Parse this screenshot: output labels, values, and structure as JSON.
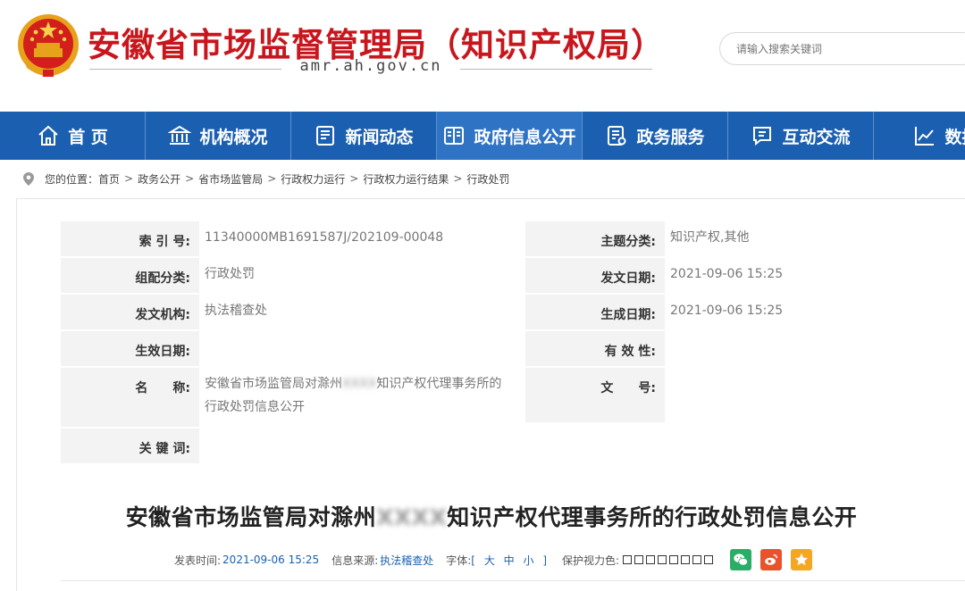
{
  "header": {
    "site_title": "安徽省市场监督管理局（知识产权局）",
    "domain": "amr.ah.gov.cn",
    "search_placeholder": "请输入搜索关键词"
  },
  "nav": {
    "items": [
      {
        "label": "首 页",
        "icon": "home-icon"
      },
      {
        "label": "机构概况",
        "icon": "building-icon"
      },
      {
        "label": "新闻动态",
        "icon": "news-icon"
      },
      {
        "label": "政府信息公开",
        "icon": "open-book-icon",
        "active": true
      },
      {
        "label": "政务服务",
        "icon": "service-icon"
      },
      {
        "label": "互动交流",
        "icon": "chat-icon"
      },
      {
        "label": "数据",
        "icon": "chart-line-icon"
      }
    ]
  },
  "breadcrumb": {
    "prefix": "您的位置：",
    "items": [
      "首页",
      "政务公开",
      "省市场监管局",
      "行政权力运行",
      "行政权力运行结果",
      "行政处罚"
    ],
    "separator": ">"
  },
  "meta": {
    "index_label": "索 引 号:",
    "index_value": "11340000MB1691587J/202109-00048",
    "topic_label": "主题分类:",
    "topic_value": "知识产权,其他",
    "category_label": "组配分类:",
    "category_value": "行政处罚",
    "issue_date_label": "发文日期:",
    "issue_date_value": "2021-09-06 15:25",
    "issuer_label": "发文机构:",
    "issuer_value": "执法稽查处",
    "created_label": "生成日期:",
    "created_value": "2021-09-06 15:25",
    "effective_label": "生效日期:",
    "effective_value": "",
    "validity_label": "有 效 性:",
    "validity_value": "",
    "name_label": "名　　称:",
    "name_value_a": "安徽省市场监管局对滁州",
    "name_value_blur": "XXXX",
    "name_value_b": "知识产权代理事务所的",
    "name_value_c": "行政处罚信息公开",
    "docno_label": "文　　号:",
    "docno_value": "",
    "keywords_label": "关 键 词:",
    "keywords_value": ""
  },
  "article": {
    "title_a": "安徽省市场监管局对滁州",
    "title_blur": "XXXX",
    "title_b": "知识产权代理事务所的行政处罚信息公开",
    "publish_label": "发表时间:",
    "publish_value": "2021-09-06 15:25",
    "source_label": "信息来源:",
    "source_value": "执法稽查处",
    "font_label": "字体:",
    "font_open": "[",
    "font_large": "大",
    "font_medium": "中",
    "font_small": "小",
    "font_close": "]",
    "eye_label": "保护视力色:",
    "share_weibo_glyph": "微"
  },
  "colors": {
    "brand_red": "#c8161d",
    "nav_blue": "#1b5fb0",
    "nav_active": "#2f73c4",
    "wechat": "#2aae67",
    "weibo": "#e8532c",
    "favorite": "#f6a623"
  }
}
